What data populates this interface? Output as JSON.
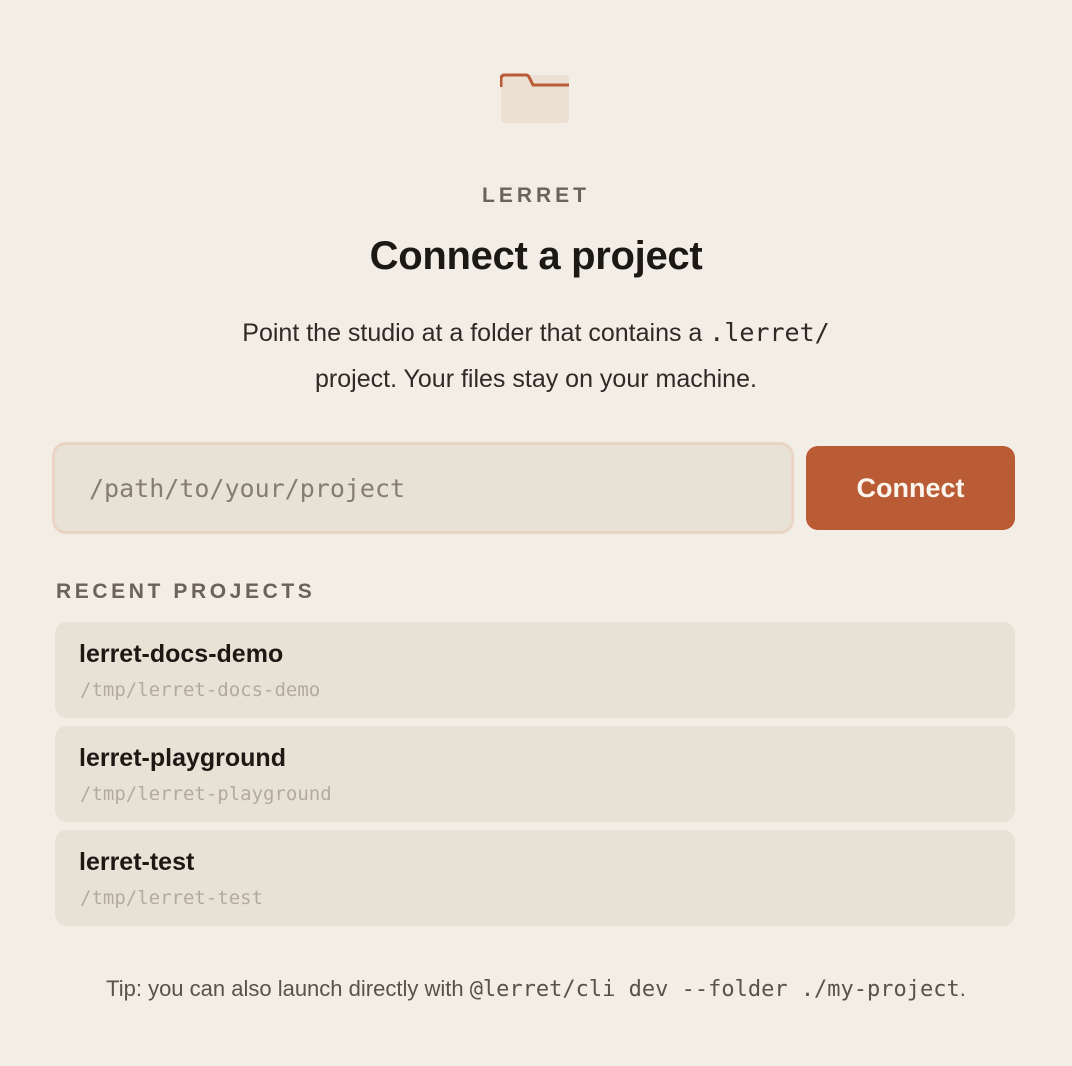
{
  "icon": {
    "name": "folder-icon",
    "accent": "#b95b34",
    "fill": "#ebe0d3"
  },
  "brand": "LERRET",
  "title": "Connect a project",
  "description": {
    "before": "Point the studio at a folder that contains a",
    "code": ".lerret/",
    "after": "project. Your files stay on your machine."
  },
  "path_input": {
    "placeholder": "/path/to/your/project",
    "value": ""
  },
  "connect_button": {
    "label": "Connect",
    "color": "#b95b34"
  },
  "recent": {
    "label": "RECENT PROJECTS",
    "items": [
      {
        "name": "lerret-docs-demo",
        "path": "/tmp/lerret-docs-demo"
      },
      {
        "name": "lerret-playground",
        "path": "/tmp/lerret-playground"
      },
      {
        "name": "lerret-test",
        "path": "/tmp/lerret-test"
      }
    ]
  },
  "tip": {
    "before": "Tip: you can also launch directly with",
    "code": "@lerret/cli dev --folder ./my-project",
    "after": "."
  }
}
